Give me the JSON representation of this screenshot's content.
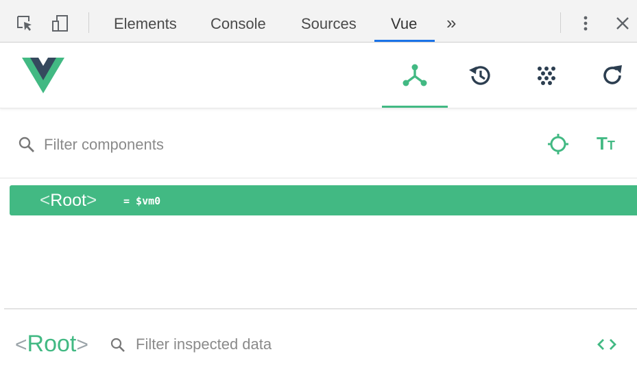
{
  "devtools": {
    "tabs": [
      {
        "label": "Elements"
      },
      {
        "label": "Console"
      },
      {
        "label": "Sources"
      },
      {
        "label": "Vue"
      }
    ],
    "active_tab": "Vue",
    "more_tabs_glyph": "»",
    "close_glyph": "✕",
    "menu_glyph": "⋮",
    "icons": [
      "inspect-element-icon",
      "device-toolbar-icon",
      "more-tabs-icon",
      "kebab-menu-icon",
      "close-icon"
    ],
    "accent": "#1a73e8"
  },
  "vue": {
    "brand_colors": {
      "green": "#42b983",
      "dark": "#35495e"
    },
    "header_buttons": [
      {
        "icon": "component-tree-icon",
        "active": true
      },
      {
        "icon": "history-icon",
        "active": false
      },
      {
        "icon": "vuex-icon",
        "active": false
      },
      {
        "icon": "refresh-icon",
        "active": false
      }
    ]
  },
  "filter": {
    "placeholder": "Filter components",
    "select_icon": "crosshair-icon",
    "format_label_big": "T",
    "format_label_small": "T"
  },
  "tree": {
    "open_bracket": "<",
    "name": "Root",
    "close_bracket": ">",
    "vm_ref": "= $vm0"
  },
  "inspector": {
    "open_bracket": "<",
    "name": "Root",
    "close_bracket": ">",
    "placeholder": "Filter inspected data",
    "code_glyph": "‹›"
  }
}
